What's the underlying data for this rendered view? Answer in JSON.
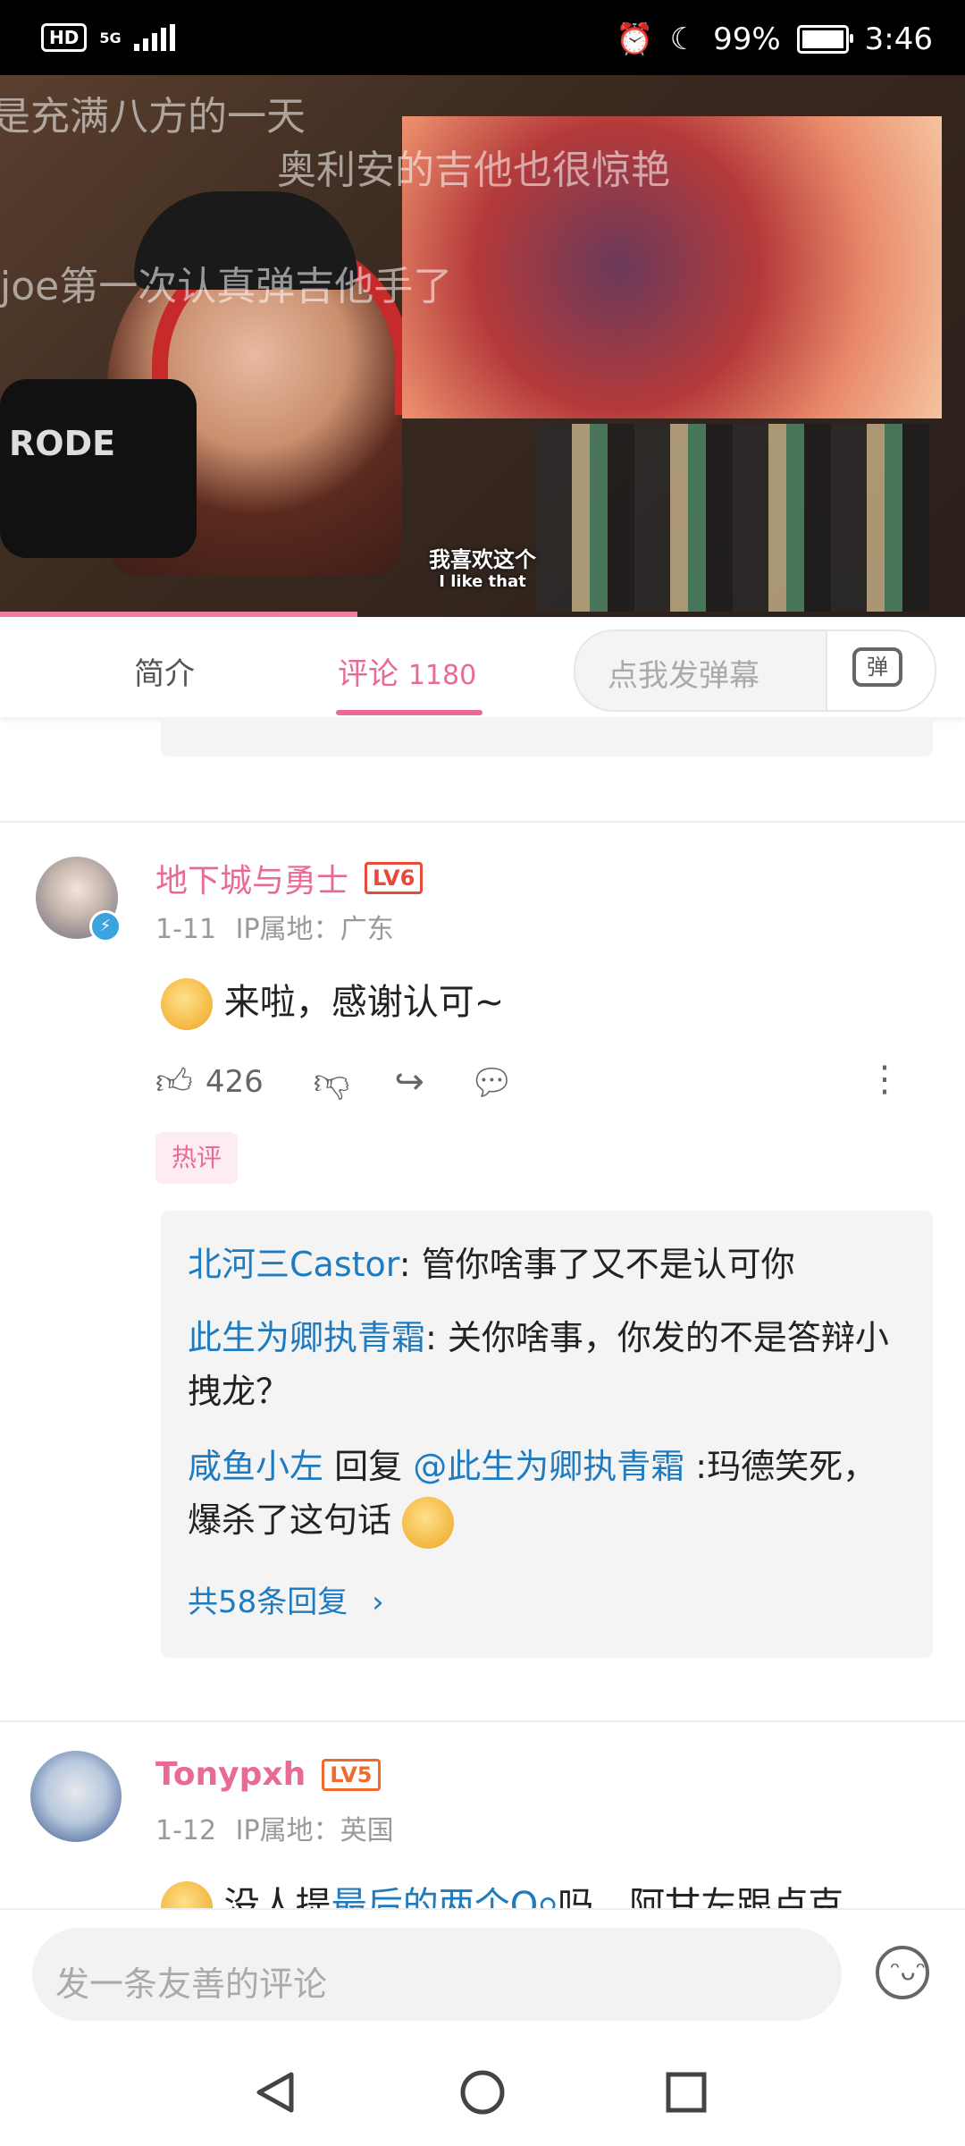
{
  "status_bar": {
    "hd": "HD",
    "network": "5G",
    "battery": "99%",
    "time": "3:46"
  },
  "video": {
    "danmaku": [
      "是充满八方的一天",
      "奥利安的吉他也很惊艳",
      "joe第一次认真弹吉他手了"
    ],
    "subtitle_cn": "我喜欢这个",
    "subtitle_en": "I like that",
    "mic_brand": "RODE"
  },
  "tabs": {
    "intro": "简介",
    "comments": "评论",
    "comments_count": "1180",
    "danmu_placeholder": "点我发弹幕",
    "danmu_button": "弹"
  },
  "comments": [
    {
      "username": "地下城与勇士",
      "level": "LV6",
      "date": "1-11",
      "ip": "IP属地：广东",
      "text": "来啦，感谢认可~",
      "likes": "426",
      "tag": "热评",
      "replies": [
        {
          "user": "北河三Castor",
          "text": ": 管你啥事了又不是认可你"
        },
        {
          "user": "此生为卿执青霜",
          "text": ": 关你啥事，你发的不是答辩小拽龙？"
        },
        {
          "user": "咸鱼小左",
          "reply_word": " 回复 ",
          "target": "@此生为卿执青霜",
          "text": " :玛德笑死，爆杀了这句话"
        }
      ],
      "more_replies": "共58条回复"
    },
    {
      "username": "Tonypxh",
      "level": "LV5",
      "date": "1-12",
      "ip": "IP属地：英国",
      "text_prefix": "没人提",
      "text_link": "最后的两个Q",
      "text_suffix": "吗，阿甘左跟卢克"
    }
  ],
  "input": {
    "placeholder": "发一条友善的评论"
  },
  "colors": {
    "accent": "#e96b95",
    "link": "#1f7bbf",
    "level": "#f06a2b"
  }
}
